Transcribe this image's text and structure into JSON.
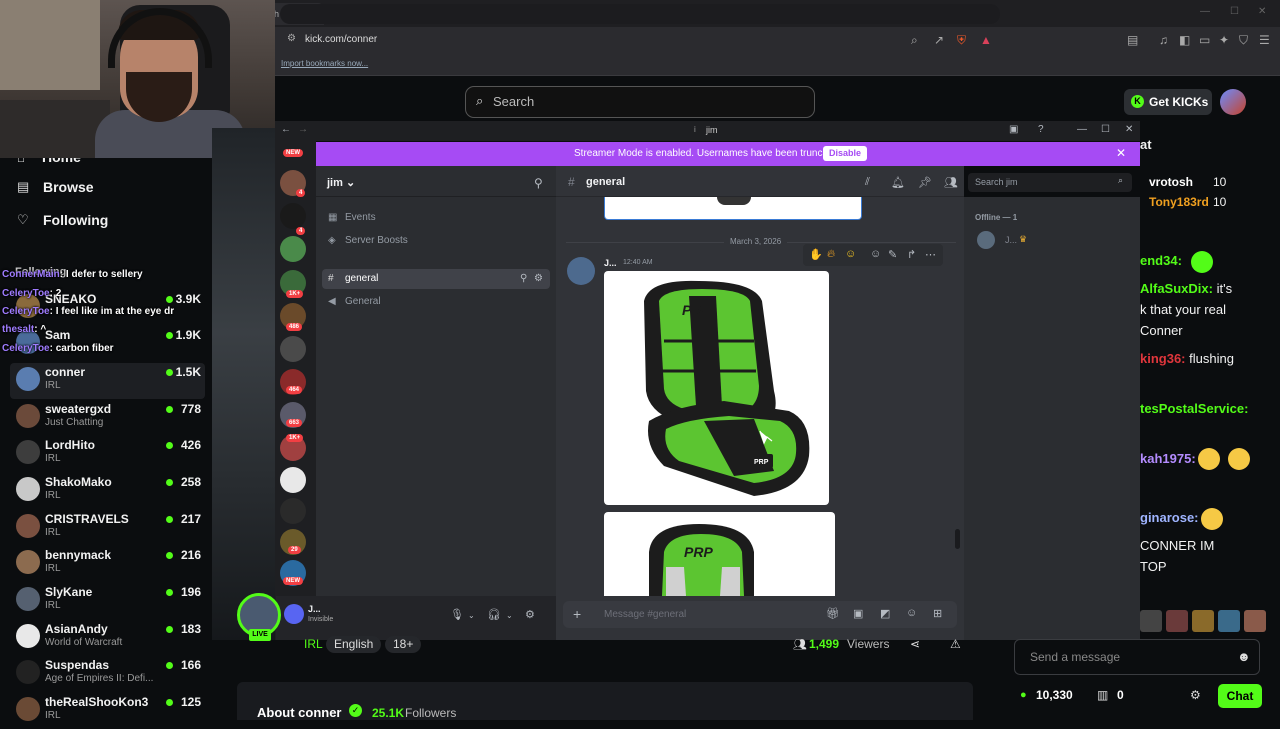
{
  "browser": {
    "tab_title": "h Live c",
    "url": "kick.com/conner",
    "bookmarks_link": "Import bookmarks now..."
  },
  "kick": {
    "search_placeholder": "Search",
    "get_kicks": "Get KICKs",
    "nav": {
      "home": "Home",
      "browse": "Browse",
      "following": "Following"
    },
    "following_header": "Following",
    "channels": [
      {
        "name": "SNEAKO",
        "category": "",
        "viewers": "3.9K",
        "color": "#8a6a3c"
      },
      {
        "name": "Sam",
        "category": "",
        "viewers": "1.9K",
        "color": "#4a6b9a"
      },
      {
        "name": "conner",
        "category": "IRL",
        "viewers": "1.5K",
        "color": "#5a7db0"
      },
      {
        "name": "sweatergxd",
        "category": "Just Chatting",
        "viewers": "778",
        "color": "#6b4a3a"
      },
      {
        "name": "LordHito",
        "category": "IRL",
        "viewers": "426",
        "color": "#3d3d3d"
      },
      {
        "name": "ShakoMako",
        "category": "IRL",
        "viewers": "258",
        "color": "#c8c8c8"
      },
      {
        "name": "CRISTRAVELS",
        "category": "IRL",
        "viewers": "217",
        "color": "#7a5040"
      },
      {
        "name": "bennymack",
        "category": "IRL",
        "viewers": "216",
        "color": "#8c6b4f"
      },
      {
        "name": "SlyKane",
        "category": "IRL",
        "viewers": "196",
        "color": "#556070"
      },
      {
        "name": "AsianAndy",
        "category": "World of Warcraft",
        "viewers": "183",
        "color": "#e8e8e8"
      },
      {
        "name": "Suspendas",
        "category": "Age of Empires II: Defi...",
        "viewers": "166",
        "color": "#222"
      },
      {
        "name": "theRealShooKon3",
        "category": "IRL",
        "viewers": "125",
        "color": "#6a4a35"
      }
    ],
    "overlay_chat": [
      {
        "name": "ConnerMain",
        "text": ": I defer to sellery"
      },
      {
        "name": "CeleryToe",
        "text": ": 2"
      },
      {
        "name": "CeleryToe",
        "text": ": I feel like im at the eye dr"
      },
      {
        "name": "thesalt",
        "text": ": ^"
      },
      {
        "name": "CeleryToe",
        "text": ": carbon fiber"
      }
    ],
    "stream": {
      "tags": [
        "IRL",
        "English",
        "18+"
      ],
      "viewers": "1,499",
      "viewers_label": "Viewers",
      "live_badge": "LIVE",
      "about_title": "About conner",
      "followers": "25.1K",
      "followers_label": "Followers"
    },
    "chat": {
      "title": "at",
      "leaderboard": [
        {
          "name": "vrotosh",
          "value": "10",
          "color": "#ffffff"
        },
        {
          "name": "Tony183rd",
          "value": "10",
          "color": "#f0a020"
        }
      ],
      "lines": [
        {
          "name": "end34:",
          "text": "",
          "color": "#53fc18"
        },
        {
          "name": "AlfaSuxDix:",
          "text": " it's",
          "color": "#53fc18"
        },
        {
          "name": "",
          "text": "k that your real",
          "color": "#fff"
        },
        {
          "name": "",
          "text": "Conner",
          "color": "#fff"
        },
        {
          "name": "king36:",
          "text": " flushing",
          "color": "#e0363c"
        },
        {
          "name": "tesPostalService:",
          "text": "",
          "color": "#53fc18"
        },
        {
          "name": "kah1975:",
          "text": "",
          "color": "#b48cff"
        },
        {
          "name": "ginarose:",
          "text": "",
          "color": "#9fb4ff"
        },
        {
          "name": "",
          "text": "CONNER IM",
          "color": "#fff"
        },
        {
          "name": "",
          "text": "TOP",
          "color": "#fff"
        }
      ],
      "input_placeholder": "Send a message",
      "kicks_balance": "10,330",
      "gift_count": "0",
      "chat_button": "Chat"
    }
  },
  "discord": {
    "window_title": "jim",
    "streamer_banner": "Streamer Mode is enabled. Usernames have been truncated.",
    "disable_button": "Disable",
    "guild_name": "jim",
    "sidebar_items": [
      "Events",
      "Server Boosts"
    ],
    "channels": [
      "general",
      "General"
    ],
    "channel_header": "general",
    "search_placeholder": "Search jim",
    "date_divider": "March 3, 2026",
    "message": {
      "author": "J...",
      "time": "12:40 AM"
    },
    "input_placeholder": "Message #general",
    "user": {
      "name": "J...",
      "status": "Invisible"
    },
    "members_header": "Offline — 1",
    "member_name": "J...",
    "server_badges": [
      "NEW",
      "4",
      "4",
      "1K+",
      "486",
      "464",
      "663",
      "1K+",
      "29",
      "NEW"
    ],
    "brand_text": "PRP"
  },
  "colors": {
    "kick_green": "#53fc18",
    "discord_purple": "#a64bf4",
    "seat_green": "#5cc531"
  }
}
